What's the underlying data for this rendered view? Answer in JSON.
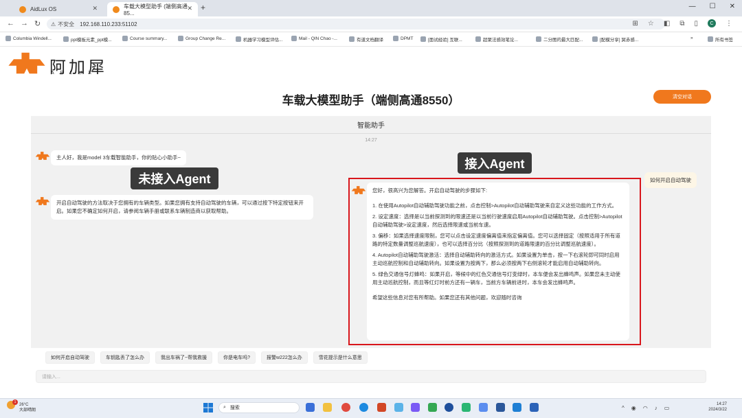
{
  "browser": {
    "tabs": [
      {
        "title": "AidLux OS"
      },
      {
        "title": "车载大模型助手 (端侧高通85..."
      }
    ],
    "new_tab": "+",
    "address": {
      "security_label": "不安全",
      "url": "192.168.110.233:51102"
    },
    "window_controls": [
      "—",
      "☐",
      "✕"
    ],
    "bookmarks": [
      "Columbia Windell...",
      "ppt模板元素_ppt模...",
      "Course summary...",
      "Group Change Re...",
      "机器学习模型评估...",
      "Mail - QIN Chao -...",
      "有道文档翻译",
      "DPMT",
      "[面试经验] 互联...",
      "超聚法感效笔论...",
      "二分图的最大匹配...",
      "[配模分享] 冥赤感..."
    ],
    "bookmarks_all": "所有书签",
    "profile_initial": "C"
  },
  "app": {
    "logo_text": "阿加犀",
    "logo_subtext": "APLUX",
    "title": "车载大模型助手（端侧高通8550）",
    "clear_button": "清空对话",
    "chat_header": "智能助手",
    "timestamp": "14:27",
    "greeting": "主人好，我是model 3车载智能助手，你的贴心小助手~",
    "label_without_agent": "未接入Agent",
    "label_with_agent": "接入Agent",
    "user_message": "如何开启自动驾驶",
    "reply_without_agent": "开启自动驾驶的方法取决于您拥有的车辆类型。如果您拥有支持自动驾驶的车辆，可以通过按下特定按钮来开启。如果您不确定如何开启，请参阅车辆手册或联系车辆制造商以获取帮助。",
    "reply_with_agent": {
      "intro": "您好，很高兴为您解答。开启自动驾驶的步骤如下:",
      "steps": [
        "1. 在使用Autopilot自动辅助驾驶功能之前，点击控制>Autopilot自动辅助驾驶来自定义这些功能的工作方式。",
        "2. 设定速度：选择是以当前探测到的限速还是以当前行驶速度启用Autopilot自动辅助驾驶。点击控制>Autopilot自动辅助驾驶>设定速度，然后选择限速或当前车速。",
        "3. 偏移：如果选择速度限制，您可以点击设定速度偏离值来指定偏离值。您可以选择固定（按照适用于所有道路的特定数量调整巡航速度），也可以选择百分比（按照探测到的道路限速的百分比调整巡航速度）。",
        "4. Autopilot自动辅助驾驶激活：选择自动辅助转向的激活方式。如果设置为单击，按一下右滚轮即可同时启用主动巡航控制和自动辅助转向。如果设置为按两下，那么必须按两下右侧滚轮才能启用自动辅助转向。",
        "5. 绿色交通信号灯蜂鸣：如果开启，等候中的红色交通信号灯变绿时，本车便会发出蜂鸣声。如果您未主动使用主动巡航控制，而且等红灯时前方还有一辆车，当前方车辆前进时，本车会发出蜂鸣声。"
      ],
      "closing": "希望这些信息对您有所帮助。如果您还有其他问题，欢迎随时咨询"
    },
    "suggestions": [
      "如何开启自动驾驶",
      "车钥匙丢了怎么办",
      "我出车祸了~帮我救援",
      "你是电车吗?",
      "报警w222怎么办",
      "雪花提示是什么意思"
    ],
    "input_placeholder": "请输入..."
  },
  "taskbar": {
    "weather_temp": "26°C",
    "weather_desc": "大部晴朗",
    "notification_count": "1",
    "search_placeholder": "搜索",
    "time": "14:27",
    "date": "2024/3/22"
  },
  "colors": {
    "accent_orange": "#f0781d",
    "highlight_red": "#d8151b",
    "tag_dark": "#3a3a3a"
  }
}
